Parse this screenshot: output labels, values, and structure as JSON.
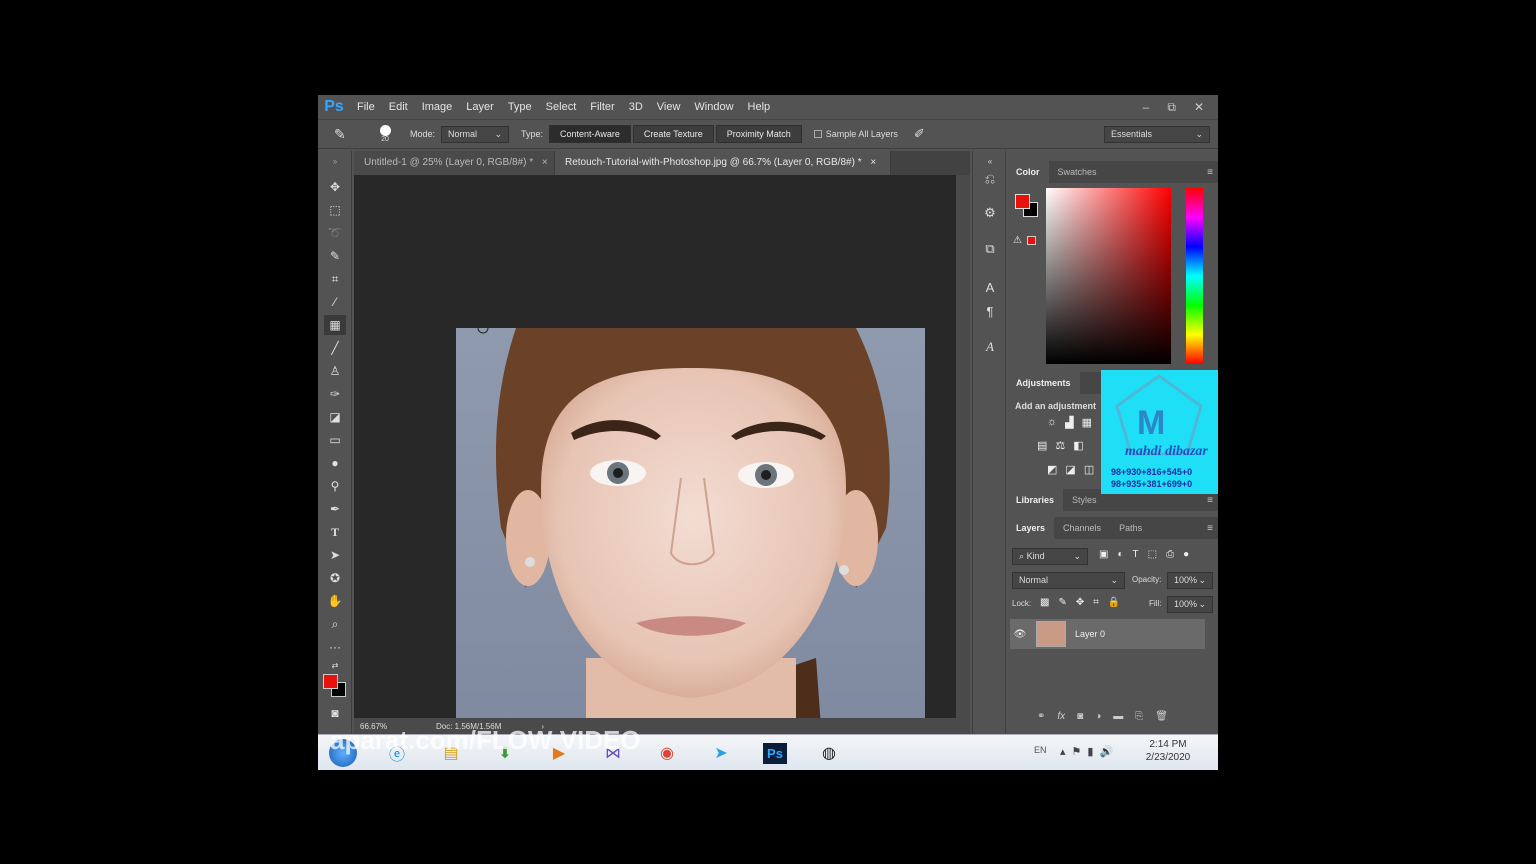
{
  "menu": {
    "logo": "Ps",
    "items": [
      "File",
      "Edit",
      "Image",
      "Layer",
      "Type",
      "Select",
      "Filter",
      "3D",
      "View",
      "Window",
      "Help"
    ]
  },
  "window_controls": {
    "minimize": "–",
    "restore": "⧉",
    "close": "✕"
  },
  "options": {
    "brush_size": "20",
    "mode_label": "Mode:",
    "mode_value": "Normal",
    "type_label": "Type:",
    "type_buttons": [
      "Content-Aware",
      "Create Texture",
      "Proximity Match"
    ],
    "sample_all_layers": "Sample All Layers",
    "workspace": "Essentials"
  },
  "tabs": [
    {
      "label": "Untitled-1 @ 25% (Layer 0, RGB/8#) *",
      "close": "×"
    },
    {
      "label": "Retouch-Tutorial-with-Photoshop.jpg @ 66.7% (Layer 0, RGB/8#) *",
      "close": "×"
    }
  ],
  "status": {
    "zoom": "66.67%",
    "doc": "Doc: 1.56M/1.56M",
    "arrow": "›"
  },
  "color_panel": {
    "tabs": [
      "Color",
      "Swatches"
    ],
    "fg_color": "#e8120c",
    "bg_color": "#000000"
  },
  "adjustments": {
    "title": "Adjustments",
    "subtitle": "Add an adjustment"
  },
  "libraries": {
    "tabs": [
      "Libraries",
      "Styles"
    ]
  },
  "layers_panel": {
    "tabs": [
      "Layers",
      "Channels",
      "Paths"
    ],
    "kind": "Kind",
    "blend_mode": "Normal",
    "opacity_label": "Opacity:",
    "opacity_value": "100%",
    "lock_label": "Lock:",
    "fill_label": "Fill:",
    "fill_value": "100%",
    "layers": [
      {
        "name": "Layer 0",
        "visible": true
      }
    ]
  },
  "watermark": {
    "letter": "M",
    "name": "mahdi dibazar",
    "phone1": "98+930+816+545+0",
    "phone2": "98+935+381+699+0"
  },
  "overlay_text": "aparat.com/FLOW VIDEO",
  "taskbar": {
    "lang": "EN",
    "time": "2:14 PM",
    "date": "2/23/2020"
  }
}
